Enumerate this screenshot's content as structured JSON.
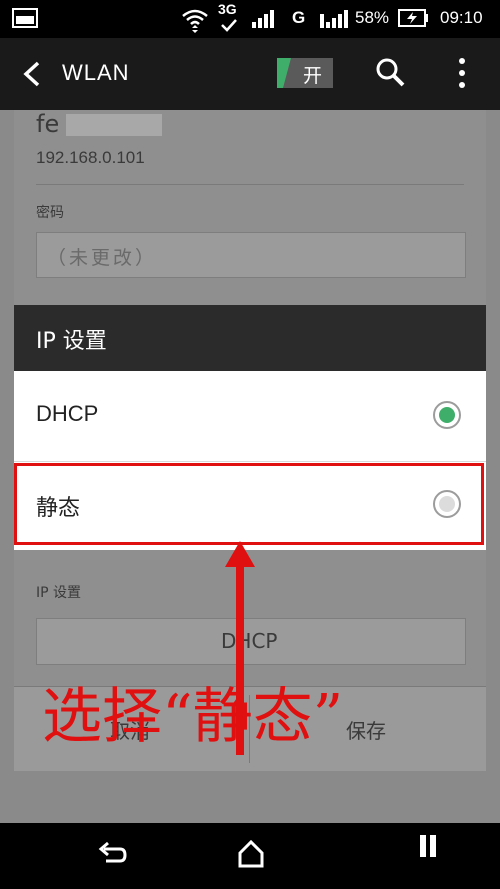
{
  "status_bar": {
    "network": "3G",
    "carrier_g": "G",
    "battery": "58%",
    "time": "09:10"
  },
  "action_bar": {
    "title": "WLAN",
    "toggle_label": "开",
    "icons": [
      "back-icon",
      "search-icon",
      "more-icon"
    ]
  },
  "background_page": {
    "network_name": "fe",
    "ip_address": "192.168.0.101",
    "password_label": "密码",
    "password_placeholder": "（未更改）",
    "ip_settings_label": "IP 设置",
    "ip_settings_value": "DHCP",
    "cancel_label": "取消",
    "save_label": "保存"
  },
  "dialog": {
    "title": "IP 设置",
    "options": [
      {
        "label": "DHCP",
        "selected": true
      },
      {
        "label": "静态",
        "selected": false
      }
    ]
  },
  "annotation": {
    "text": "选择“静态”"
  },
  "colors": {
    "accent_green": "#3fae6a",
    "annotation_red": "#e01010",
    "dialog_title_bg": "#2b2b2b"
  }
}
